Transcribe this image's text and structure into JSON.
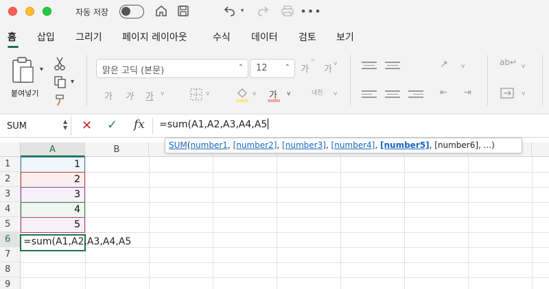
{
  "titlebar": {
    "autosave_label": "자동 저장",
    "icons": [
      "home-icon",
      "save-icon",
      "undo-icon",
      "redo-icon",
      "print-icon",
      "more-icon"
    ]
  },
  "ribbon_tabs": [
    {
      "label": "홈",
      "active": true
    },
    {
      "label": "삽입",
      "active": false
    },
    {
      "label": "그리기",
      "active": false
    },
    {
      "label": "페이지 레이아웃",
      "active": false
    },
    {
      "label": "수식",
      "active": false
    },
    {
      "label": "데이터",
      "active": false
    },
    {
      "label": "검토",
      "active": false
    },
    {
      "label": "보기",
      "active": false
    }
  ],
  "ribbon": {
    "paste_label": "붙여넣기",
    "font_name": "맑은 고딕 (본문)",
    "font_size": "12",
    "grow_font": "가",
    "shrink_font": "가",
    "bold": "가",
    "italic": "가",
    "underline": "가",
    "font_color_glyph": "가",
    "wrap_label": "내천"
  },
  "formula_bar": {
    "name_box": "SUM",
    "formula": "=sum(A1,A2,A3,A4,A5"
  },
  "tooltip": {
    "func": "SUM",
    "open_paren": "(",
    "arg1": "number1",
    "arg2": "[number2]",
    "arg3": "[number3]",
    "arg4": "[number4]",
    "arg5": "[number5]",
    "rest": ", [number6], ...)",
    "sep": ", "
  },
  "grid": {
    "columns": [
      "A",
      "B"
    ],
    "rows": [
      "1",
      "2",
      "3",
      "4",
      "5",
      "6",
      "7",
      "8",
      "9"
    ],
    "cells": [
      "1",
      "2",
      "3",
      "4",
      "5"
    ],
    "edit_cell": "=sum(A1,A2,A3,A4,A5"
  },
  "colors": {
    "accent": "#1e7145",
    "ref_a1": "#3f7fc0",
    "ref_a2": "#c0392b",
    "ref_a3": "#8e44ad",
    "ref_a4": "#2e7d32",
    "ref_a5": "#b03a7d"
  }
}
